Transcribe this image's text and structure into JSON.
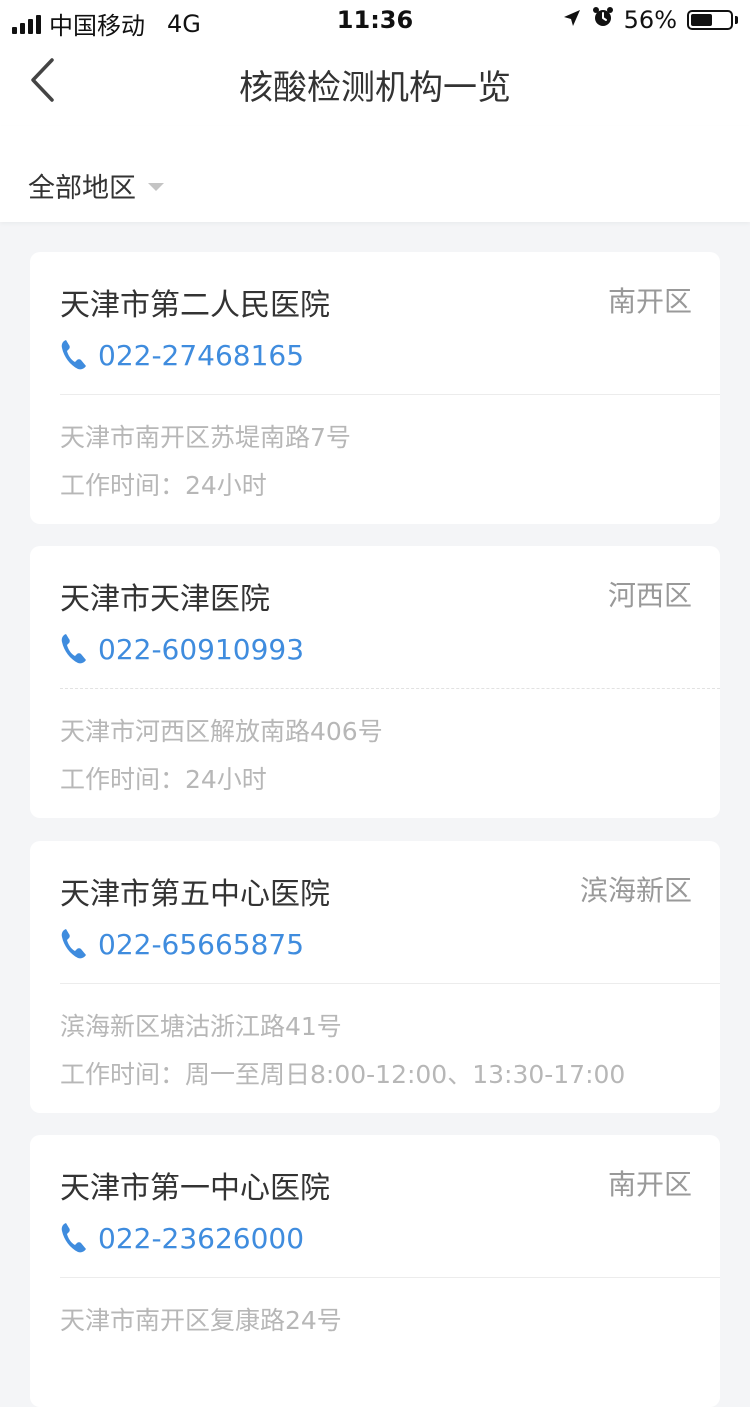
{
  "status_bar": {
    "carrier": "中国移动",
    "network": "4G",
    "time": "11:36",
    "battery": "56%",
    "battery_level": 0.56,
    "icons": [
      "signal-bars-icon",
      "location-arrow-icon",
      "alarm-clock-icon",
      "battery-icon"
    ]
  },
  "nav": {
    "title": "核酸检测机构一览",
    "back_icon": "chevron-left-icon"
  },
  "filter": {
    "region_label": "全部地区",
    "caret_icon": "caret-down-icon"
  },
  "colors": {
    "accent": "#3f8cde",
    "text_primary": "#333333",
    "text_secondary": "#999999",
    "text_muted": "#b7b7b7",
    "background": "#f4f5f7"
  },
  "institutions": [
    {
      "name": "天津市第二人民医院",
      "district": "南开区",
      "phone": "022-27468165",
      "address": "天津市南开区苏堤南路7号",
      "hours": "工作时间：24小时"
    },
    {
      "name": "天津市天津医院",
      "district": "河西区",
      "phone": "022-60910993",
      "address": "天津市河西区解放南路406号",
      "hours": "工作时间：24小时"
    },
    {
      "name": "天津市第五中心医院",
      "district": "滨海新区",
      "phone": "022-65665875",
      "address": "滨海新区塘沽浙江路41号",
      "hours": "工作时间：周一至周日8:00-12:00、13:30-17:00"
    },
    {
      "name": "天津市第一中心医院",
      "district": "南开区",
      "phone": "022-23626000",
      "address": "天津市南开区复康路24号",
      "hours": ""
    }
  ]
}
